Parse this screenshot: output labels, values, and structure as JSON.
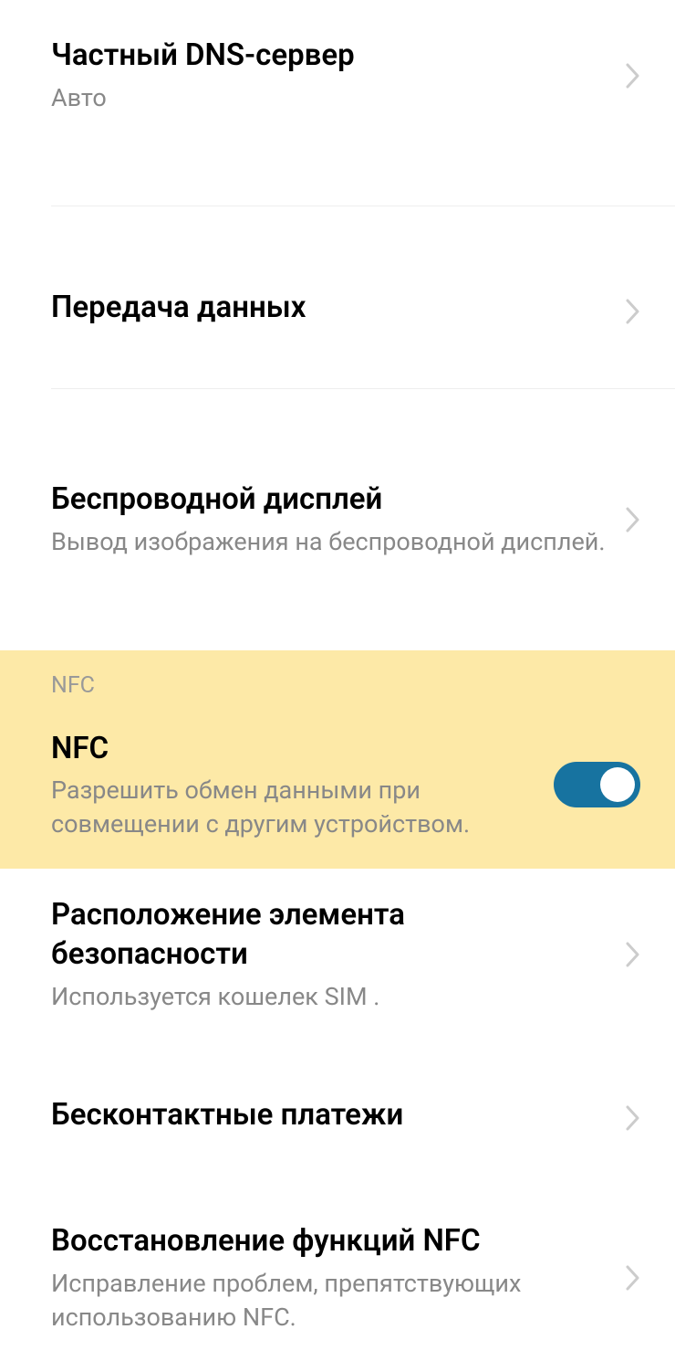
{
  "items": {
    "dns": {
      "title": "Частный DNS-сервер",
      "subtitle": "Авто"
    },
    "dataTransfer": {
      "title": "Передача данных"
    },
    "wirelessDisplay": {
      "title": "Беспроводной дисплей",
      "subtitle": "Вывод изображения на беспроводной дисплей."
    },
    "nfcSection": {
      "header": "NFC"
    },
    "nfc": {
      "title": "NFC",
      "subtitle": "Разрешить обмен данными при совмещении с другим устройством."
    },
    "securityElement": {
      "title": "Расположение элемента безопасности",
      "subtitle": "Используется кошелек SIM ."
    },
    "contactlessPayments": {
      "title": "Бесконтактные платежи"
    },
    "nfcRestore": {
      "title": "Восстановление функций NFC",
      "subtitle": "Исправление проблем, препятствующих использованию NFC."
    }
  }
}
